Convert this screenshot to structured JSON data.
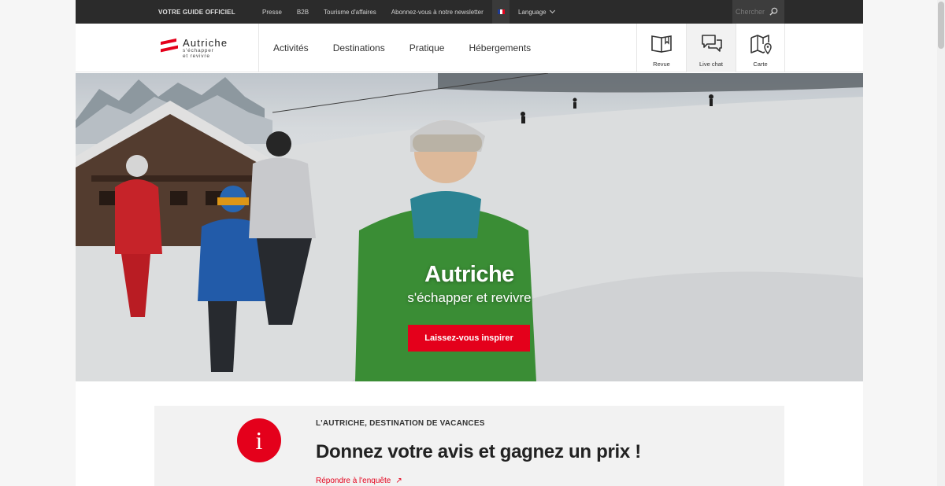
{
  "topbar": {
    "guide_label": "VOTRE GUIDE OFFICIEL",
    "links": [
      "Presse",
      "B2B",
      "Tourisme d'affaires",
      "Abonnez-vous à notre newsletter"
    ],
    "language_label": "Language",
    "search_placeholder": "Chercher",
    "flag_colors": [
      "#1f3a93",
      "#ffffff",
      "#e4001b"
    ]
  },
  "header": {
    "logo": {
      "title": "Autriche",
      "sub1": "s'échapper",
      "sub2": "et revivre"
    },
    "nav": [
      "Activités",
      "Destinations",
      "Pratique",
      "Hébergements"
    ],
    "tools": [
      {
        "label": "Revue",
        "icon": "book-icon"
      },
      {
        "label": "Live chat",
        "icon": "chat-bubbles-icon"
      },
      {
        "label": "Carte",
        "icon": "map-pin-icon"
      }
    ]
  },
  "hero": {
    "title": "Autriche",
    "subtitle": "s'échapper et revivre",
    "cta_label": "Laissez-vous inspirer"
  },
  "survey": {
    "icon_glyph": "i",
    "kicker": "L'AUTRICHE, DESTINATION DE VACANCES",
    "title": "Donnez votre avis et gagnez un prix !",
    "link_label": "Répondre à l'enquête",
    "link_arrow": "↗"
  },
  "colors": {
    "accent": "#e4001b",
    "topbar_bg": "#2b2b2b"
  }
}
